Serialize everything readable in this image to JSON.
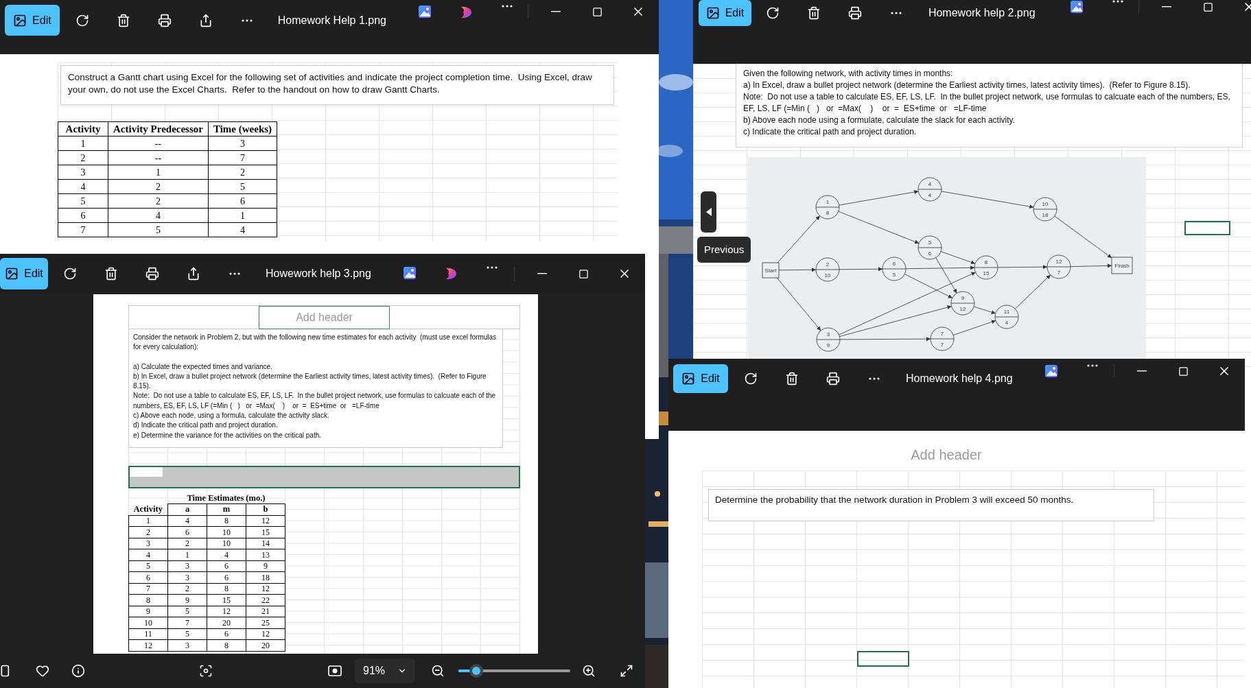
{
  "windows": [
    {
      "kind": "gantt",
      "title": "Homework Help 1.png",
      "edit_label": "Edit",
      "tools": [
        {
          "kind": "rotate"
        },
        {
          "kind": "delete"
        },
        {
          "kind": "print"
        },
        {
          "kind": "share"
        },
        {
          "kind": "more"
        }
      ],
      "apps": [
        {
          "kind": "photos"
        },
        {
          "kind": "copilot"
        },
        {
          "kind": "more"
        }
      ],
      "instructions": "Construct a Gantt chart using Excel for the following set of activities and indicate the project completion time.  Using Excel, draw your own, do not use the Excel Charts.  Refer to the handout on how to draw Gantt Charts.",
      "table": {
        "columns": [
          "Activity",
          "Activity Predecessor",
          "Time (weeks)"
        ],
        "rows": [
          [
            "1",
            "--",
            "3"
          ],
          [
            "2",
            "--",
            "7"
          ],
          [
            "3",
            "1",
            "2"
          ],
          [
            "4",
            "2",
            "5"
          ],
          [
            "5",
            "2",
            "6"
          ],
          [
            "6",
            "4",
            "1"
          ],
          [
            "7",
            "5",
            "4"
          ]
        ]
      }
    },
    {
      "kind": "network",
      "title": "Homework help 2.png",
      "edit_label": "Edit",
      "tools": [
        {
          "kind": "rotate"
        },
        {
          "kind": "delete"
        },
        {
          "kind": "print"
        },
        {
          "kind": "more"
        }
      ],
      "apps": [
        {
          "kind": "photos"
        },
        {
          "kind": "more"
        }
      ],
      "instructions": {
        "intro": "Given the following network, with activity times in months:",
        "items": [
          "a) In Excel, draw a bullet project network (determine the Earliest activity times, latest activity times).  (Refer to Figure 8.15).",
          "Note:  Do not use a table to calculate ES, EF, LS, LF.  In the bullet project network, use formulas to calcuate each of the numbers, ES, EF, LS, LF (=Min (   )   or  =Max(    )    or  =  ES+time  or   =LF-time",
          "b) Above each node using a formulate, calculate the slack for each activity.",
          "c) Indicate the critical path and project duration."
        ]
      },
      "network": {
        "start": "Start",
        "finish": "Finish",
        "nodes": [
          {
            "activity": "1",
            "time": "8"
          },
          {
            "activity": "2",
            "time": "10"
          },
          {
            "activity": "3",
            "time": "9"
          },
          {
            "activity": "4",
            "time": "4"
          },
          {
            "activity": "5",
            "time": "6"
          },
          {
            "activity": "6",
            "time": "5"
          },
          {
            "activity": "7",
            "time": "7"
          },
          {
            "activity": "8",
            "time": "15"
          },
          {
            "activity": "9",
            "time": "12"
          },
          {
            "activity": "10",
            "time": "18"
          },
          {
            "activity": "11",
            "time": "4"
          },
          {
            "activity": "12",
            "time": "7"
          }
        ]
      },
      "previous_tooltip": "Previous"
    },
    {
      "kind": "estimates",
      "title": "Howework help 3.png",
      "edit_label": "Edit",
      "tools": [
        {
          "kind": "rotate"
        },
        {
          "kind": "delete"
        },
        {
          "kind": "print"
        },
        {
          "kind": "share"
        },
        {
          "kind": "more"
        }
      ],
      "apps": [
        {
          "kind": "photos"
        },
        {
          "kind": "copilot"
        },
        {
          "kind": "more"
        }
      ],
      "header_placeholder": "Add header",
      "instructions": {
        "intro": "Consider the network in Problem 2, but with the following new time estimates for each activity  (must use excel formulas for every calculation):",
        "items": [
          "a) Calculate the expected times and variance.",
          "b) In Excel, draw a bullet project network (determine the Earliest activity times, latest activity times).  (Refer to Figure 8.15).",
          "Note:  Do not use a table to calculate ES, EF, LS, LF.  In the bullet project network, use formulas to calcuate each of the numbers, ES, EF, LS, LF (=Min (   )   or  =Max(    )    or  =  ES+time  or   =LF-time",
          "c) Above each node, using a formula, calculate the activity slack.",
          "d) Indicate the critical path and project duration.",
          "e) Determine the variance for the activities on the critical path."
        ]
      },
      "table": {
        "title": "Time Estimates (mo.)",
        "columns": [
          "Activity",
          "a",
          "m",
          "b"
        ],
        "rows": [
          [
            "1",
            "4",
            "8",
            "12"
          ],
          [
            "2",
            "6",
            "10",
            "15"
          ],
          [
            "3",
            "2",
            "10",
            "14"
          ],
          [
            "4",
            "1",
            "4",
            "13"
          ],
          [
            "5",
            "3",
            "6",
            "9"
          ],
          [
            "6",
            "3",
            "6",
            "18"
          ],
          [
            "7",
            "2",
            "8",
            "12"
          ],
          [
            "8",
            "9",
            "15",
            "22"
          ],
          [
            "9",
            "5",
            "12",
            "21"
          ],
          [
            "10",
            "7",
            "20",
            "25"
          ],
          [
            "11",
            "5",
            "6",
            "12"
          ],
          [
            "12",
            "3",
            "8",
            "20"
          ]
        ]
      },
      "zoom": {
        "label": "91%",
        "level": 0.16
      }
    },
    {
      "kind": "probability",
      "title": "Homework help 4.png",
      "edit_label": "Edit",
      "tools": [
        {
          "kind": "rotate"
        },
        {
          "kind": "delete"
        },
        {
          "kind": "print"
        },
        {
          "kind": "more"
        }
      ],
      "apps": [
        {
          "kind": "photos"
        },
        {
          "kind": "more"
        }
      ],
      "header_placeholder": "Add header",
      "instructions": "Determine the probability that the network duration in Problem 3 will exceed 50 months."
    }
  ]
}
